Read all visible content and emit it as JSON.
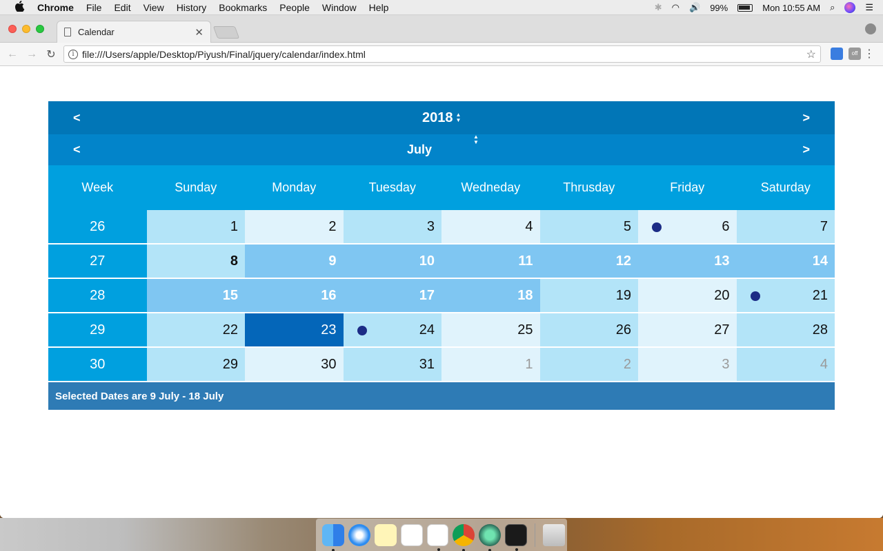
{
  "menubar": {
    "apple": "",
    "items": [
      "Chrome",
      "File",
      "Edit",
      "View",
      "History",
      "Bookmarks",
      "People",
      "Window",
      "Help"
    ],
    "battery": "99%",
    "clock": "Mon 10:55 AM"
  },
  "browser": {
    "tab_title": "Calendar",
    "url": "file:///Users/apple/Desktop/Piyush/Final/jquery/calendar/index.html",
    "ext2_label": "off"
  },
  "calendar": {
    "prev": "<",
    "next": ">",
    "year": "2018",
    "month": "July",
    "headers": [
      "Week",
      "Sunday",
      "Monday",
      "Tuesday",
      "Wedneday",
      "Thrusday",
      "Friday",
      "Saturday"
    ],
    "weeks": [
      {
        "week": "26",
        "days": [
          {
            "d": "1",
            "s": "mid",
            "dot": false
          },
          {
            "d": "2",
            "s": "light",
            "dot": false
          },
          {
            "d": "3",
            "s": "mid",
            "dot": false
          },
          {
            "d": "4",
            "s": "light",
            "dot": false
          },
          {
            "d": "5",
            "s": "mid",
            "dot": false
          },
          {
            "d": "6",
            "s": "light",
            "dot": true
          },
          {
            "d": "7",
            "s": "mid",
            "dot": false
          }
        ]
      },
      {
        "week": "27",
        "days": [
          {
            "d": "8",
            "s": "mid bold",
            "dot": false
          },
          {
            "d": "9",
            "s": "range",
            "dot": false
          },
          {
            "d": "10",
            "s": "range",
            "dot": false
          },
          {
            "d": "11",
            "s": "range",
            "dot": false
          },
          {
            "d": "12",
            "s": "range",
            "dot": false
          },
          {
            "d": "13",
            "s": "range",
            "dot": false
          },
          {
            "d": "14",
            "s": "range",
            "dot": false
          }
        ]
      },
      {
        "week": "28",
        "days": [
          {
            "d": "15",
            "s": "range",
            "dot": false
          },
          {
            "d": "16",
            "s": "range",
            "dot": false
          },
          {
            "d": "17",
            "s": "range",
            "dot": false
          },
          {
            "d": "18",
            "s": "range",
            "dot": false
          },
          {
            "d": "19",
            "s": "mid",
            "dot": false
          },
          {
            "d": "20",
            "s": "light",
            "dot": false
          },
          {
            "d": "21",
            "s": "mid",
            "dot": true
          }
        ]
      },
      {
        "week": "29",
        "days": [
          {
            "d": "22",
            "s": "mid",
            "dot": false
          },
          {
            "d": "23",
            "s": "today",
            "dot": false
          },
          {
            "d": "24",
            "s": "mid",
            "dot": true
          },
          {
            "d": "25",
            "s": "light",
            "dot": false
          },
          {
            "d": "26",
            "s": "mid",
            "dot": false
          },
          {
            "d": "27",
            "s": "light",
            "dot": false
          },
          {
            "d": "28",
            "s": "mid",
            "dot": false
          }
        ]
      },
      {
        "week": "30",
        "days": [
          {
            "d": "29",
            "s": "mid",
            "dot": false
          },
          {
            "d": "30",
            "s": "light",
            "dot": false
          },
          {
            "d": "31",
            "s": "mid",
            "dot": false
          },
          {
            "d": "1",
            "s": "light muted",
            "dot": false
          },
          {
            "d": "2",
            "s": "mid muted",
            "dot": false
          },
          {
            "d": "3",
            "s": "light muted",
            "dot": false
          },
          {
            "d": "4",
            "s": "mid muted",
            "dot": false
          }
        ]
      }
    ],
    "footer": "Selected Dates are 9 July - 18 July"
  },
  "colors": {
    "year_bar": "#0176b7",
    "month_bar": "#0284ca",
    "header_bar": "#00a0df",
    "range": "#7fc6f2",
    "today": "#0466b9",
    "event_dot": "#1c2c86",
    "footer": "#2e7bb5"
  },
  "dock": {
    "icons": [
      "finder-icon",
      "safari-icon",
      "notes-icon",
      "reminders-icon",
      "slack-icon",
      "chrome-icon",
      "atom-icon",
      "terminal-icon",
      "trash-icon"
    ]
  }
}
